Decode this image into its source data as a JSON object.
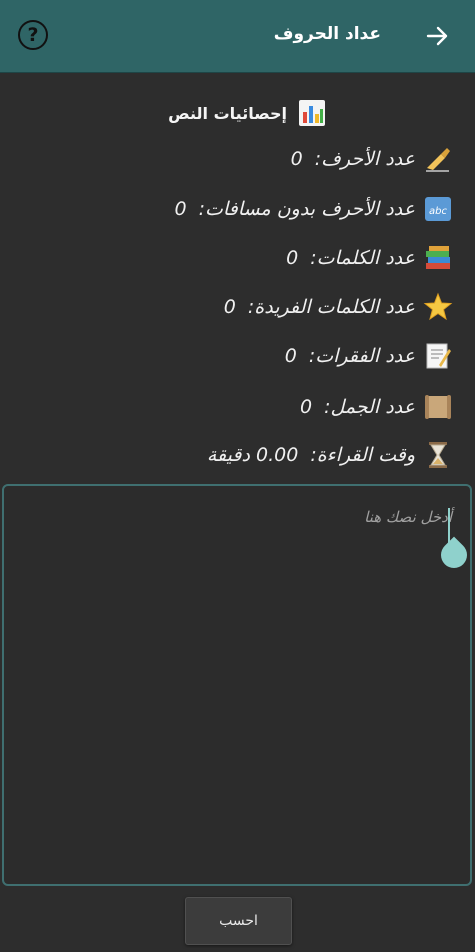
{
  "header": {
    "title": "عداد الحروف",
    "help_label": "?",
    "background": "#2f6566"
  },
  "stats": {
    "heading": "إحصائيات النص",
    "items": [
      {
        "label": "عدد الأحرف:",
        "value": "0",
        "icon": "writing-hand-icon"
      },
      {
        "label": "عدد الأحرف بدون مسافات:",
        "value": "0",
        "icon": "abc-icon"
      },
      {
        "label": "عدد الكلمات:",
        "value": "0",
        "icon": "books-icon"
      },
      {
        "label": "عدد الكلمات الفريدة:",
        "value": "0",
        "icon": "star-icon"
      },
      {
        "label": "عدد الفقرات:",
        "value": "0",
        "icon": "memo-icon"
      },
      {
        "label": "عدد الجمل:",
        "value": "0",
        "icon": "scroll-icon"
      },
      {
        "label": "وقت القراءة:",
        "value": "0.00 دقيقة",
        "icon": "hourglass-icon"
      }
    ]
  },
  "input": {
    "placeholder": "أدخل نصك هنا",
    "value": ""
  },
  "actions": {
    "calculate_label": "احسب"
  },
  "colors": {
    "accent": "#2f6566",
    "background": "#2d2d2d",
    "caret": "#8fd1cc"
  }
}
